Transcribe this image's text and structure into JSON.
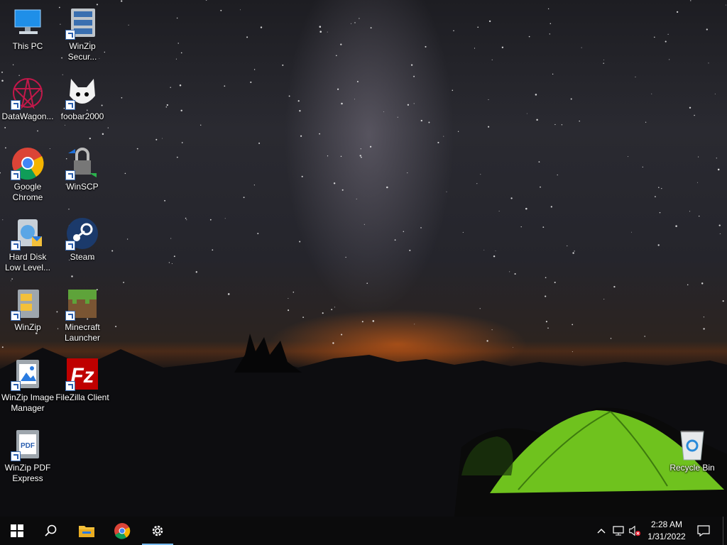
{
  "desktop": {
    "icons": [
      {
        "label": "This PC"
      },
      {
        "label": "WinZip Secur..."
      },
      {
        "label": "DataWagon..."
      },
      {
        "label": "foobar2000"
      },
      {
        "label": "Google Chrome"
      },
      {
        "label": "WinSCP"
      },
      {
        "label": "Hard Disk Low Level..."
      },
      {
        "label": "Steam"
      },
      {
        "label": "WinZip"
      },
      {
        "label": "Minecraft Launcher"
      },
      {
        "label": "WinZip Image Manager"
      },
      {
        "label": "FileZilla Client"
      },
      {
        "label": "WinZip PDF Express"
      },
      {
        "label": "Recycle Bin"
      }
    ]
  },
  "taskbar": {
    "pinned": [
      "start-icon",
      "search-icon",
      "file-explorer-icon",
      "chrome-icon",
      "settings-icon"
    ],
    "active_app": "settings-icon",
    "clock_time": "2:28 AM",
    "clock_date": "1/31/2022",
    "accent_color": "#76b9ed"
  }
}
